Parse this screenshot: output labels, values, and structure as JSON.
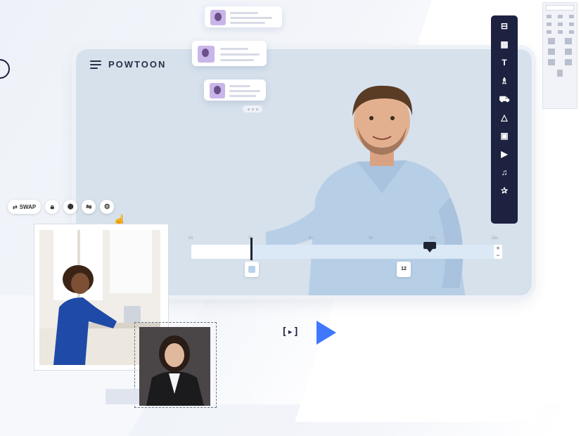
{
  "brand": {
    "name": "POWTOON"
  },
  "timeline": {
    "ticks": [
      "0s",
      "3s",
      "6s",
      "9s",
      "12s",
      "15s"
    ],
    "zoom_in": "+",
    "zoom_out": "−",
    "keyframe_label": "12"
  },
  "toolbar": {
    "swap_label": "SWAP",
    "tools": [
      {
        "icon": "layout-icon",
        "glyph": "⊟"
      },
      {
        "icon": "texture-icon",
        "glyph": "▦"
      },
      {
        "icon": "text-icon",
        "glyph": "T"
      },
      {
        "icon": "characters-icon",
        "glyph": "♗"
      },
      {
        "icon": "props-icon",
        "glyph": "⛟"
      },
      {
        "icon": "shapes-icon",
        "glyph": "△"
      },
      {
        "icon": "media-icon",
        "glyph": "▣"
      },
      {
        "icon": "video-icon",
        "glyph": "▶"
      },
      {
        "icon": "music-icon",
        "glyph": "♫"
      },
      {
        "icon": "specials-icon",
        "glyph": "✰"
      }
    ]
  },
  "player": {
    "play_code": "[▸]"
  },
  "colors": {
    "accent": "#3f78ff",
    "dark": "#1d2240",
    "canvas": "#d6e1ec"
  }
}
